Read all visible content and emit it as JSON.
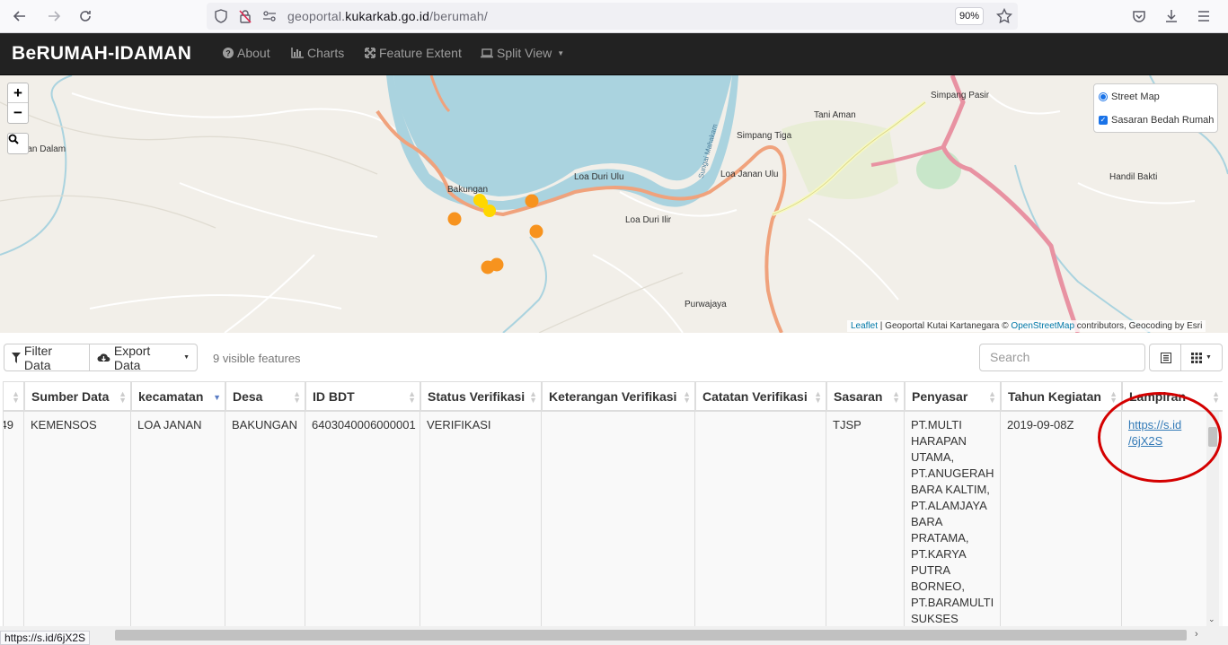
{
  "browser": {
    "url_prefix": "geoportal.",
    "url_domain": "kukarkab.go.id",
    "url_path": "/berumah/",
    "zoom": "90%"
  },
  "navbar": {
    "brand": "BeRUMAH-IDAMAN",
    "items": [
      {
        "label": "About",
        "icon": "question-circle-icon"
      },
      {
        "label": "Charts",
        "icon": "bar-chart-icon"
      },
      {
        "label": "Feature Extent",
        "icon": "fullscreen-icon"
      },
      {
        "label": "Split View",
        "icon": "laptop-icon"
      }
    ]
  },
  "map": {
    "zoom_in": "+",
    "zoom_out": "−",
    "place_labels": [
      "Bakungan",
      "Loa Duri Ulu",
      "Loa Duri Ilir",
      "Loa Janan Ulu",
      "Simpang Tiga",
      "Tani Aman",
      "Simpang Pasir",
      "Handil Bakti",
      "Purwajaya",
      "...an Dalam",
      "Sungai Mahakam"
    ],
    "layers": {
      "base": "Street Map",
      "overlay": "Sasaran Bedah Rumah"
    },
    "attribution_link1": "Leaflet",
    "attribution_text1": " | Geoportal Kutai Kartanegara © ",
    "attribution_link2": "OpenStreetMap",
    "attribution_text2": " contributors, Geocoding by Esri",
    "marker_colors": {
      "orange": "#f7931e",
      "yellow": "#ffd700"
    }
  },
  "toolbar": {
    "filter": "Filter Data",
    "export": "Export Data",
    "visible_count": "9 visible features",
    "search_placeholder": "Search"
  },
  "table": {
    "headers": [
      "Sumber Data",
      "kecamatan",
      "Desa",
      "ID BDT",
      "Status Verifikasi",
      "Keterangan Verifikasi",
      "Catatan Verifikasi",
      "Sasaran",
      "Penyasar",
      "Tahun Kegiatan",
      "Lampiran"
    ],
    "row": {
      "first_cell": "49",
      "sumber_data": "KEMENSOS",
      "kecamatan": "LOA JANAN",
      "desa": "BAKUNGAN",
      "id_bdt": "6403040006000001",
      "status": "VERIFIKASI",
      "keterangan": "",
      "catatan": "",
      "sasaran": "TJSP",
      "penyasar": "PT.MULTI HARAPAN UTAMA, PT.ANUGERAH BARA KALTIM, PT.ALAMJAYA BARA PRATAMA, PT.KARYA PUTRA BORNEO, PT.BARAMULTI SUKSES",
      "tahun": "2019-09-08Z",
      "lampiran_line1": "https://s.id",
      "lampiran_line2": "/6jX2S"
    }
  },
  "status_bar": "https://s.id/6jX2S",
  "highlight_color": "#d40000"
}
